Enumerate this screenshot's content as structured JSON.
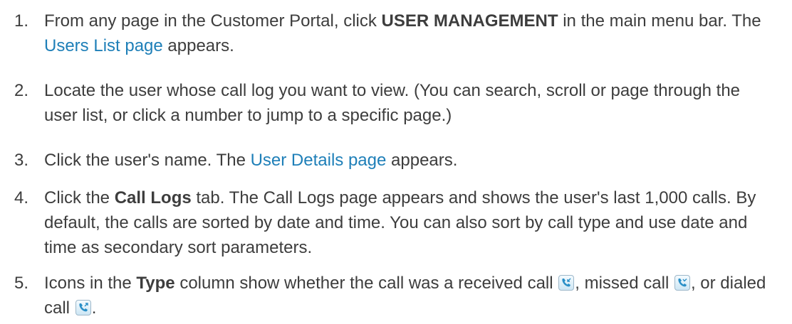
{
  "steps": [
    {
      "number": "1.",
      "t1": "From any page in the Customer Portal, click ",
      "b1": "USER MANAGEMENT",
      "t2": " in the main menu bar. The ",
      "link": "Users List page",
      "t3": " appears."
    },
    {
      "number": "2.",
      "t1": "Locate the user whose call log you want to view. (You can search, scroll or page through the user list, or click a number to jump to a specific page.)"
    },
    {
      "number": "3.",
      "t1": "Click the user's name. The ",
      "link": "User Details page",
      "t2": " appears."
    },
    {
      "number": "4.",
      "t1": "Click the ",
      "b1": "Call Logs",
      "t2": " tab. The Call Logs page appears and shows the user's last 1,000 calls. By default, the calls are sorted by date and time. You can also sort by call type and use date and time as secondary sort parameters."
    },
    {
      "number": "5.",
      "t1": "Icons in the ",
      "b1": "Type",
      "t2": " column show whether the call was a received call ",
      "t3": ", missed call ",
      "t4": ", or dialed call ",
      "t5": "."
    }
  ],
  "icons": {
    "received": "received-call-icon",
    "missed": "missed-call-icon",
    "dialed": "dialed-call-icon"
  },
  "colors": {
    "text": "#3d3d3d",
    "link": "#1e7fb8",
    "icon_accent": "#2a8fc7"
  }
}
